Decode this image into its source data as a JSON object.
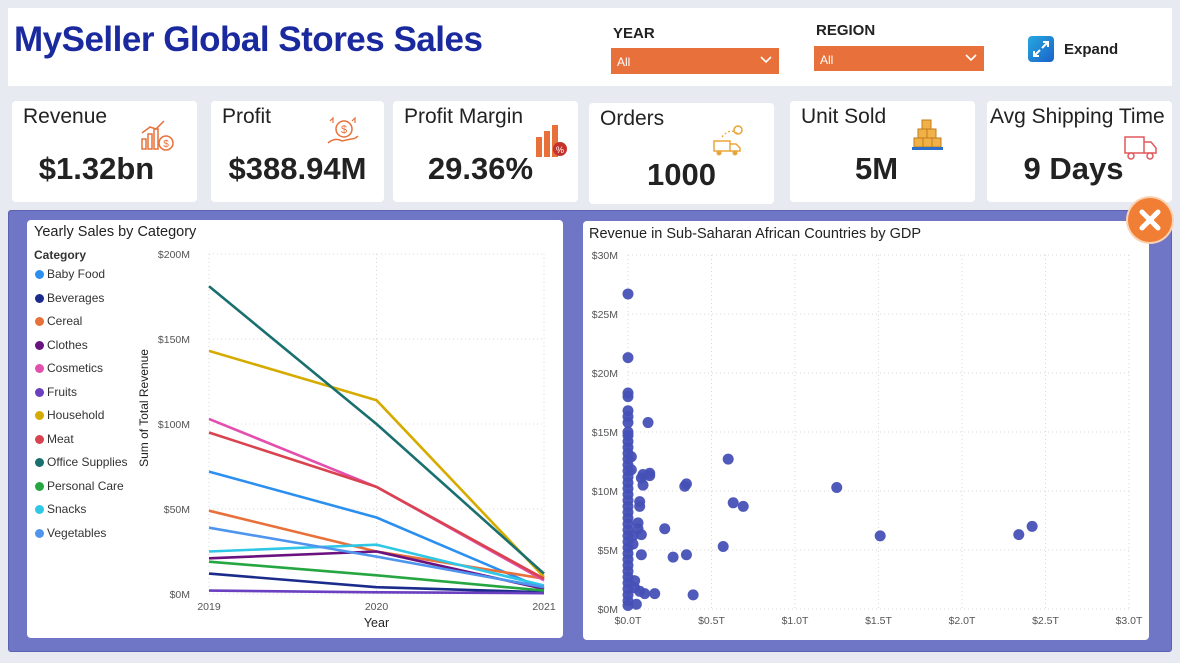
{
  "header": {
    "title": "MySeller Global Stores Sales",
    "year_label": "YEAR",
    "year_value": "All",
    "region_label": "REGION",
    "region_value": "All",
    "expand_label": "Expand"
  },
  "kpis": [
    {
      "label": "Revenue",
      "value": "$1.32bn",
      "icon": "revenue-chart-icon"
    },
    {
      "label": "Profit",
      "value": "$388.94M",
      "icon": "profit-hand-coin-icon"
    },
    {
      "label": "Profit Margin",
      "value": "29.36%",
      "icon": "profit-margin-icon"
    },
    {
      "label": "Orders",
      "value": "1000",
      "icon": "delivery-truck-icon"
    },
    {
      "label": "Unit Sold",
      "value": "5M",
      "icon": "boxes-icon"
    },
    {
      "label": "Avg Shipping Time",
      "value": "9 Days",
      "icon": "shipping-truck-icon"
    }
  ],
  "colors": {
    "accent": "#e8703a",
    "title": "#1a2a9e",
    "panel": "#6f76c6",
    "scatter": "#4651b6"
  },
  "chart_data": [
    {
      "type": "line",
      "title": "Yearly Sales by Category",
      "legend_title": "Category",
      "legend_position": "left",
      "xlabel": "Year",
      "ylabel": "Sum of Total Revenue",
      "categories": [
        "2019",
        "2020",
        "2021"
      ],
      "ylim": [
        0,
        200000000
      ],
      "yticks": [
        "$0M",
        "$50M",
        "$100M",
        "$150M",
        "$200M"
      ],
      "grid": true,
      "series": [
        {
          "name": "Baby Food",
          "color": "#2b8ff0",
          "values": [
            72000000,
            45000000,
            3000000
          ]
        },
        {
          "name": "Beverages",
          "color": "#1b2b8c",
          "values": [
            12000000,
            4000000,
            1000000
          ]
        },
        {
          "name": "Cereal",
          "color": "#e8703a",
          "values": [
            49000000,
            25000000,
            9000000
          ]
        },
        {
          "name": "Clothes",
          "color": "#6a1380",
          "values": [
            21000000,
            25000000,
            3000000
          ]
        },
        {
          "name": "Cosmetics",
          "color": "#e34fae",
          "values": [
            103000000,
            63000000,
            8000000
          ]
        },
        {
          "name": "Fruits",
          "color": "#6a3fc0",
          "values": [
            2000000,
            1000000,
            500000
          ]
        },
        {
          "name": "Household",
          "color": "#d6ab00",
          "values": [
            143000000,
            114000000,
            10000000
          ]
        },
        {
          "name": "Meat",
          "color": "#d9434f",
          "values": [
            95000000,
            63000000,
            9000000
          ]
        },
        {
          "name": "Office Supplies",
          "color": "#1a6f6f",
          "values": [
            181000000,
            100000000,
            12000000
          ]
        },
        {
          "name": "Personal Care",
          "color": "#26a641",
          "values": [
            19000000,
            11000000,
            2000000
          ]
        },
        {
          "name": "Snacks",
          "color": "#2fc7e6",
          "values": [
            25000000,
            29000000,
            5000000
          ]
        },
        {
          "name": "Vegetables",
          "color": "#4f95ee",
          "values": [
            39000000,
            22000000,
            4000000
          ]
        }
      ]
    },
    {
      "type": "scatter",
      "title": "Revenue in Sub-Saharan African Countries by GDP",
      "xlim": [
        0,
        3000000000000
      ],
      "ylim": [
        0,
        30000000
      ],
      "xticks": [
        "$0.0T",
        "$0.5T",
        "$1.0T",
        "$1.5T",
        "$2.0T",
        "$2.5T",
        "$3.0T"
      ],
      "yticks": [
        "$0M",
        "$5M",
        "$10M",
        "$15M",
        "$20M",
        "$25M",
        "$30M"
      ],
      "grid": true,
      "series": [
        {
          "color": "#4651b6",
          "points": [
            [
              0,
              26700000
            ],
            [
              0,
              21300000
            ],
            [
              0,
              18300000
            ],
            [
              0,
              18000000
            ],
            [
              0,
              16800000
            ],
            [
              0,
              16300000
            ],
            [
              0,
              15800000
            ],
            [
              0,
              15000000
            ],
            [
              0,
              14700000
            ],
            [
              0,
              14200000
            ],
            [
              0,
              13700000
            ],
            [
              0,
              13200000
            ],
            [
              0,
              12700000
            ],
            [
              0,
              12200000
            ],
            [
              0,
              11700000
            ],
            [
              0,
              11200000
            ],
            [
              0,
              10700000
            ],
            [
              0,
              10200000
            ],
            [
              0,
              9700000
            ],
            [
              0,
              9200000
            ],
            [
              0,
              8700000
            ],
            [
              0,
              8200000
            ],
            [
              0,
              7700000
            ],
            [
              0,
              7200000
            ],
            [
              0,
              6700000
            ],
            [
              0,
              6200000
            ],
            [
              0,
              5700000
            ],
            [
              0,
              5200000
            ],
            [
              0,
              4700000
            ],
            [
              0,
              4200000
            ],
            [
              0,
              3700000
            ],
            [
              0,
              3200000
            ],
            [
              0,
              2700000
            ],
            [
              0,
              2200000
            ],
            [
              0,
              1700000
            ],
            [
              0,
              1200000
            ],
            [
              0,
              700000
            ],
            [
              0,
              300000
            ],
            [
              20000000000,
              12900000
            ],
            [
              20000000000,
              11800000
            ],
            [
              30000000000,
              6200000
            ],
            [
              30000000000,
              5500000
            ],
            [
              40000000000,
              1800000
            ],
            [
              40000000000,
              2400000
            ],
            [
              50000000000,
              400000
            ],
            [
              60000000000,
              7300000
            ],
            [
              60000000000,
              6800000
            ],
            [
              70000000000,
              8700000
            ],
            [
              70000000000,
              9100000
            ],
            [
              70000000000,
              1500000
            ],
            [
              80000000000,
              4600000
            ],
            [
              80000000000,
              6300000
            ],
            [
              80000000000,
              11100000
            ],
            [
              90000000000,
              11400000
            ],
            [
              90000000000,
              10500000
            ],
            [
              100000000000,
              1300000
            ],
            [
              120000000000,
              15800000
            ],
            [
              130000000000,
              11500000
            ],
            [
              130000000000,
              11300000
            ],
            [
              160000000000,
              1300000
            ],
            [
              220000000000,
              6800000
            ],
            [
              270000000000,
              4400000
            ],
            [
              340000000000,
              10400000
            ],
            [
              350000000000,
              10600000
            ],
            [
              350000000000,
              4600000
            ],
            [
              390000000000,
              1200000
            ],
            [
              570000000000,
              5300000
            ],
            [
              600000000000,
              12700000
            ],
            [
              630000000000,
              9000000
            ],
            [
              690000000000,
              8700000
            ],
            [
              1250000000000,
              10300000
            ],
            [
              1510000000000,
              6200000
            ],
            [
              2340000000000,
              6300000
            ],
            [
              2420000000000,
              7000000
            ]
          ]
        }
      ]
    }
  ]
}
